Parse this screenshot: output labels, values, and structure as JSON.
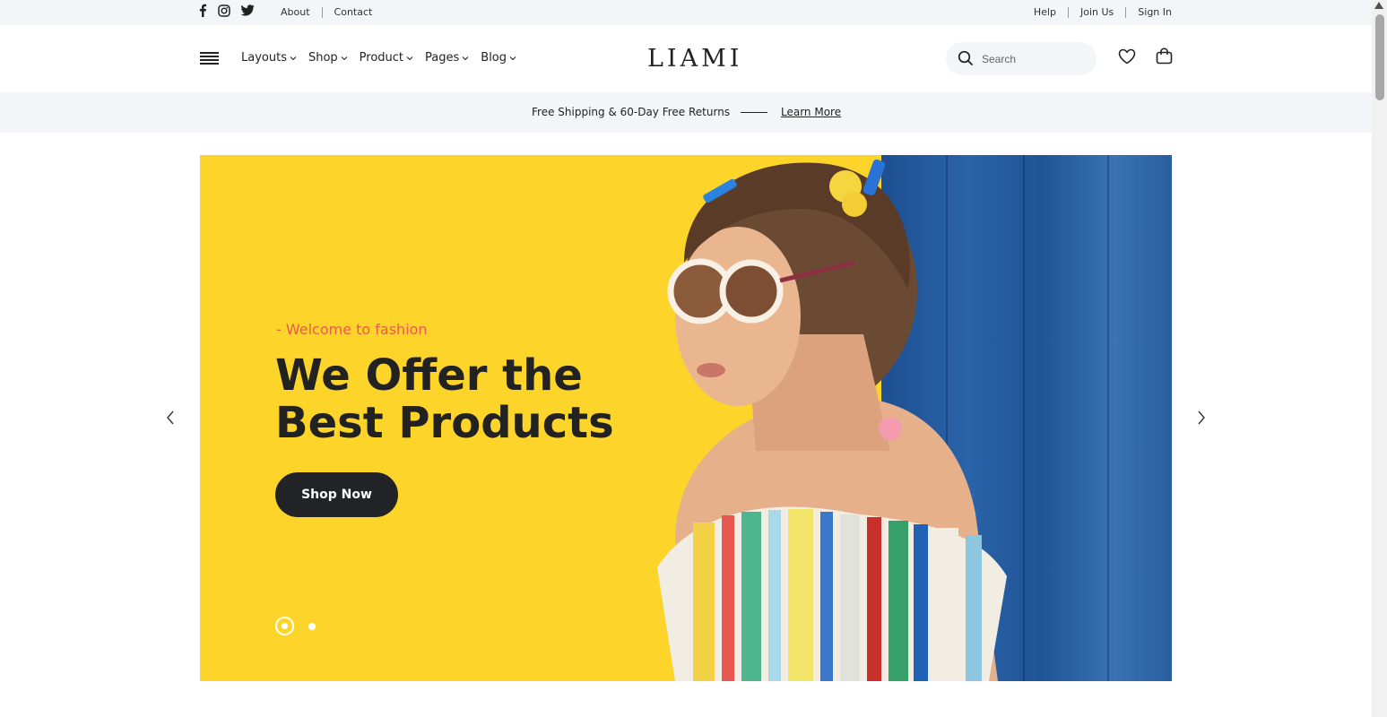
{
  "topbar": {
    "social_icons": [
      "facebook-icon",
      "instagram-icon",
      "twitter-icon"
    ],
    "left_links": [
      "About",
      "Contact"
    ],
    "right_links": [
      "Help",
      "Join Us",
      "Sign In"
    ]
  },
  "header": {
    "logo": "LIAMI",
    "nav": [
      "Layouts",
      "Shop",
      "Product",
      "Pages",
      "Blog"
    ],
    "search_placeholder": "Search",
    "icons": [
      "menu-icon",
      "search-icon",
      "heart-icon",
      "bag-icon"
    ]
  },
  "promo": {
    "text": "Free Shipping & 60-Day Free Returns",
    "link": "Learn More"
  },
  "hero": {
    "subtitle": "- Welcome to fashion",
    "title": "We Offer the Best Products",
    "button": "Shop Now",
    "slides_count": 2,
    "active_slide": 1,
    "colors": {
      "background": "#fdd52a",
      "subtitle": "#ec5a4a",
      "button": "#222327"
    }
  }
}
